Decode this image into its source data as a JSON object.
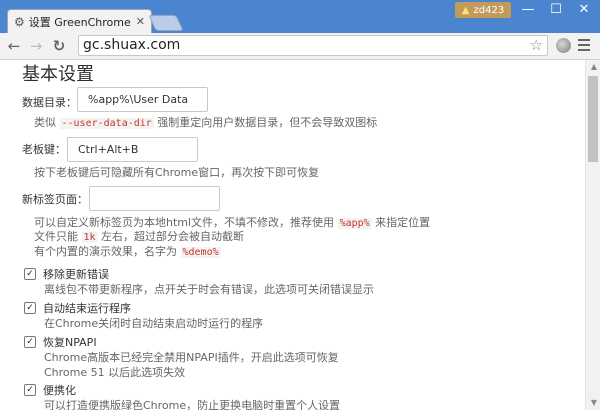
{
  "window": {
    "tab_title": "设置 GreenChrome",
    "user_name": "zd423",
    "controls": {
      "minimize": "—",
      "maximize": "☐",
      "close": "✕"
    }
  },
  "toolbar": {
    "url": "gc.shuax.com",
    "icons": [
      "back-arrow-icon",
      "forward-arrow-icon",
      "reload-icon",
      "star-icon",
      "extension-icon",
      "menu-icon"
    ]
  },
  "page": {
    "heading": "基本设置",
    "data_dir": {
      "label": "数据目录：",
      "value": "%app%\\User Data",
      "hint_prefix": "类似 ",
      "hint_code": "--user-data-dir",
      "hint_suffix": " 强制重定向用户数据目录，但不会导致双图标"
    },
    "boss_key": {
      "label": "老板键：",
      "value": "Ctrl+Alt+B",
      "hint": "按下老板键后可隐藏所有Chrome窗口，再次按下即可恢复"
    },
    "new_tab": {
      "label": "新标签页面：",
      "value": "",
      "hint1_prefix": "可以自定义新标签页为本地html文件，不填不修改，推荐使用 ",
      "hint1_code": "%app%",
      "hint1_suffix": " 来指定位置",
      "hint2_prefix": "文件只能 ",
      "hint2_code": "1k",
      "hint2_suffix": " 左右，超过部分会被自动截断",
      "hint3_prefix": "有个内置的演示效果，名字为 ",
      "hint3_code": "%demo%"
    },
    "options": [
      {
        "label": "移除更新错误",
        "checked": true,
        "hint": "离线包不带更新程序，点开关于时会有错误，此选项可关闭错误显示"
      },
      {
        "label": "自动结束运行程序",
        "checked": true,
        "hint": "在Chrome关闭时自动结束启动时运行的程序"
      },
      {
        "label": "恢复NPAPI",
        "checked": true,
        "hint": "Chrome高版本已经完全禁用NPAPI插件，开启此选项可恢复",
        "hint2": "Chrome 51 以后此选项失效"
      },
      {
        "label": "便携化",
        "checked": true,
        "hint": "可以打造便携版绿色Chrome，防止更换电脑时重置个人设置"
      }
    ]
  }
}
